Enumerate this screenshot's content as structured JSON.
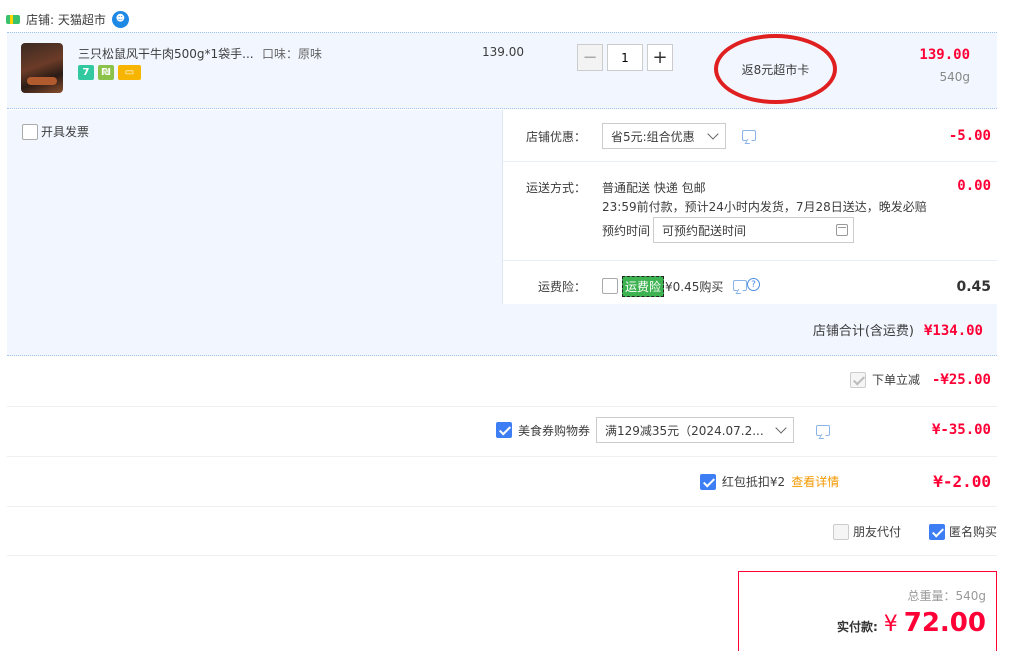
{
  "shop": {
    "label": "店铺: 天猫超市"
  },
  "item": {
    "title": "三只松鼠风干牛肉500g*1袋手...",
    "flavor": "口味：原味",
    "unit_price": "139.00",
    "quantity": "1",
    "minus": "−",
    "plus": "+",
    "badges": [
      "7",
      "₪",
      ""
    ],
    "note": "返8元超市卡",
    "total": "139.00",
    "weight": "540g"
  },
  "invoice": {
    "label": "开具发票"
  },
  "store_discount": {
    "label": "店铺优惠：",
    "selected": "省5元:组合优惠",
    "amount": "-5.00"
  },
  "delivery": {
    "label": "运送方式：",
    "method": "普通配送 快递 包邮",
    "detail": "23:59前付款，预计24小时内发货，7月28日送达，晚发必赔",
    "appoint_label": "预约时间",
    "appoint_placeholder": "可预约配送时间",
    "amount": "0.00"
  },
  "insurance": {
    "label": "运费险：",
    "tag": "运费险",
    "price": "¥0.45购买",
    "help": "?",
    "amount": "0.45"
  },
  "shop_total": {
    "label": "店铺合计(含运费)",
    "amount": "¥134.00"
  },
  "instant_discount": {
    "label": "下单立减",
    "amount": "-¥25.00"
  },
  "food_coupon": {
    "label": "美食券购物券",
    "selected": "满129减35元（2024.07.2...",
    "amount": "¥-35.00"
  },
  "red_packet": {
    "label": "红包抵扣¥2",
    "link": "查看详情",
    "amount": "¥-2.00"
  },
  "options": {
    "friend_pay": "朋友代付",
    "anonymous": "匿名购买"
  },
  "pay": {
    "weight_label": "总重量：540g",
    "pay_label": "实付款:",
    "currency": "¥",
    "amount": "72.00"
  },
  "colors": {
    "price_red": "#ff0036",
    "panel_bg": "#f2f7ff",
    "check_blue": "#3d7ef5",
    "circle_red": "#e02020"
  }
}
